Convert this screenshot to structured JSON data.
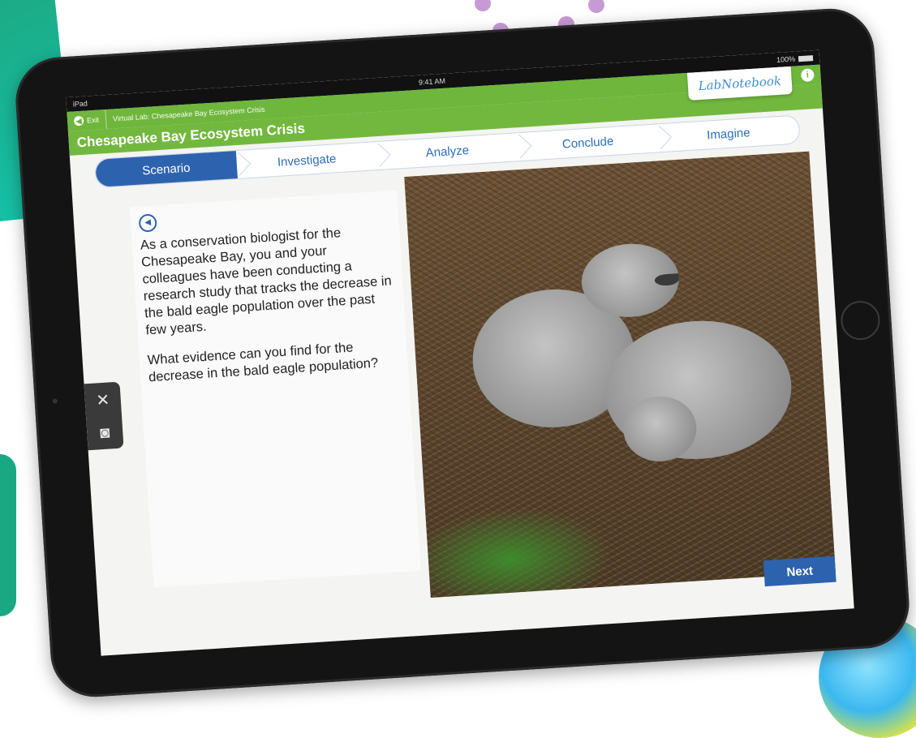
{
  "status_bar": {
    "carrier": "iPad",
    "time": "9:41 AM",
    "battery": "100%"
  },
  "topbar": {
    "exit_label": "Exit",
    "breadcrumb": "Virtual Lab: Chesapeake Bay Ecosystem Crisis",
    "info_icon": "info-icon"
  },
  "lab_notebook_label": "LabNotebook",
  "title": "Chesapeake Bay Ecosystem Crisis",
  "steps": [
    {
      "label": "Scenario",
      "active": true
    },
    {
      "label": "Investigate",
      "active": false
    },
    {
      "label": "Analyze",
      "active": false
    },
    {
      "label": "Conclude",
      "active": false
    },
    {
      "label": "Imagine",
      "active": false
    }
  ],
  "scenario": {
    "audio_icon": "speaker-icon",
    "paragraph_1": "As a conservation biologist for the Chesapeake Bay, you and your colleagues have been conducting a research study that tracks the decrease in the bald eagle population over the past few years.",
    "paragraph_2": "What evidence can you find for the decrease in the bald eagle population?"
  },
  "tools": [
    {
      "icon": "tools-icon",
      "glyph": "✕"
    },
    {
      "icon": "camera-icon",
      "glyph": "◙"
    }
  ],
  "next_label": "Next",
  "colors": {
    "header_green": "#6fb63c",
    "primary_blue": "#2d63ae"
  }
}
